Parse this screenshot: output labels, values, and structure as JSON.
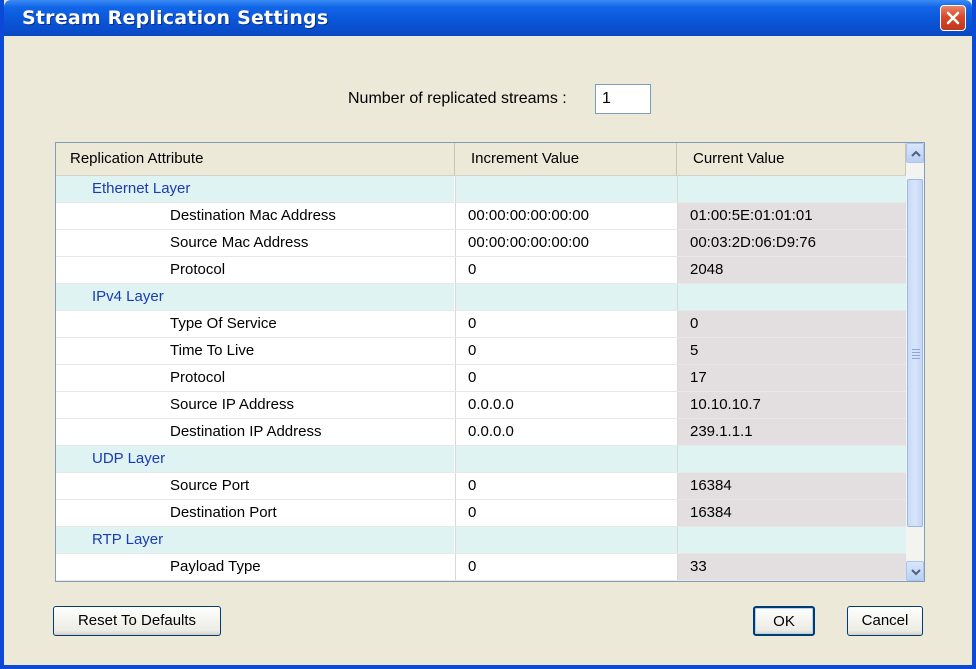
{
  "window": {
    "title": "Stream Replication Settings"
  },
  "streams": {
    "label": "Number of replicated streams  :",
    "value": "1"
  },
  "grid": {
    "headers": [
      "Replication Attribute",
      "Increment Value",
      "Current Value"
    ],
    "rows": [
      {
        "type": "layer",
        "name": "Ethernet Layer",
        "increment": "",
        "current": ""
      },
      {
        "type": "attr",
        "name": "Destination Mac Address",
        "increment": "00:00:00:00:00:00",
        "current": "01:00:5E:01:01:01"
      },
      {
        "type": "attr",
        "name": "Source Mac Address",
        "increment": "00:00:00:00:00:00",
        "current": "00:03:2D:06:D9:76"
      },
      {
        "type": "attr",
        "name": "Protocol",
        "increment": "0",
        "current": "2048"
      },
      {
        "type": "layer",
        "name": "IPv4 Layer",
        "increment": "",
        "current": ""
      },
      {
        "type": "attr",
        "name": "Type Of Service",
        "increment": "0",
        "current": "0"
      },
      {
        "type": "attr",
        "name": "Time To Live",
        "increment": "0",
        "current": "5"
      },
      {
        "type": "attr",
        "name": "Protocol",
        "increment": "0",
        "current": "17"
      },
      {
        "type": "attr",
        "name": "Source IP Address",
        "increment": "0.0.0.0",
        "current": "10.10.10.7"
      },
      {
        "type": "attr",
        "name": "Destination IP Address",
        "increment": "0.0.0.0",
        "current": "239.1.1.1"
      },
      {
        "type": "layer",
        "name": "UDP Layer",
        "increment": "",
        "current": ""
      },
      {
        "type": "attr",
        "name": "Source Port",
        "increment": "0",
        "current": "16384"
      },
      {
        "type": "attr",
        "name": "Destination Port",
        "increment": "0",
        "current": "16384"
      },
      {
        "type": "layer",
        "name": "RTP Layer",
        "increment": "",
        "current": ""
      },
      {
        "type": "attr",
        "name": "Payload Type",
        "increment": "0",
        "current": "33"
      }
    ]
  },
  "buttons": {
    "reset": "Reset To Defaults",
    "ok": "OK",
    "cancel": "Cancel"
  },
  "colors": {
    "title_bar": "#0a55d8",
    "layer_text": "#1a3bb8",
    "layer_row_bg": "#dff3f3",
    "current_value_bg": "#e3dfe0"
  },
  "icons": {
    "close": "close-icon",
    "scroll_up": "scroll-up-arrow-icon",
    "scroll_down": "scroll-down-arrow-icon"
  }
}
